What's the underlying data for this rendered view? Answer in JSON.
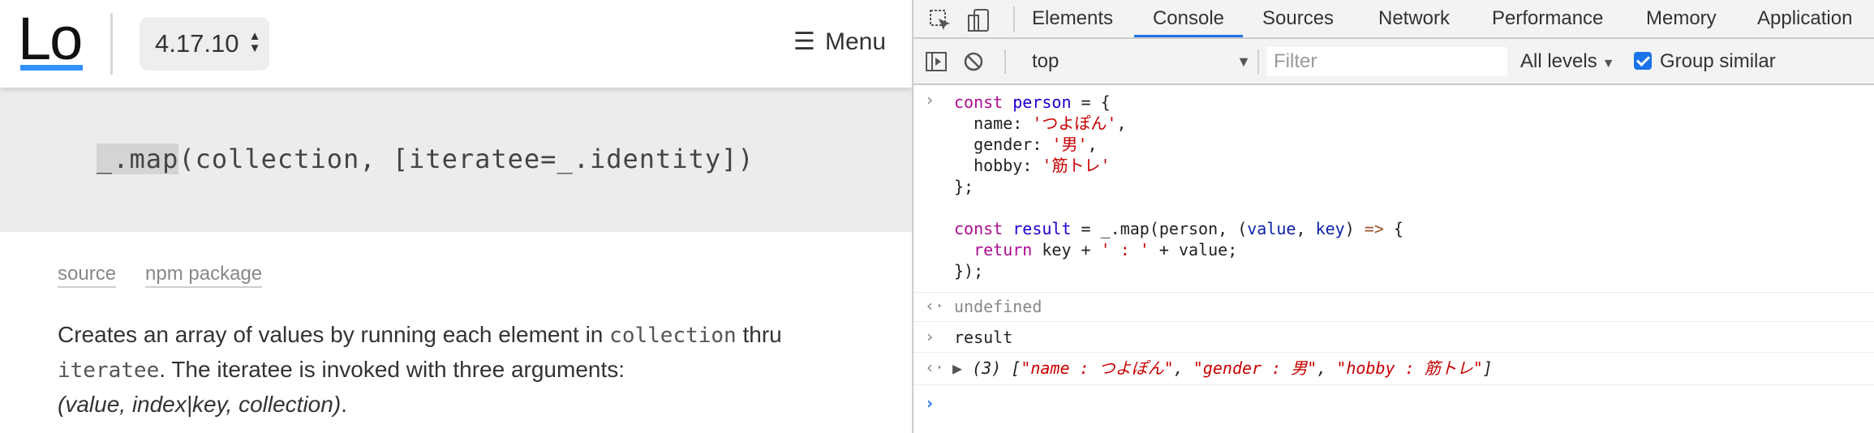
{
  "docs": {
    "logo_text": "Lo",
    "version": "4.17.10",
    "menu_label": "Menu",
    "signature": {
      "highlight": "_.map",
      "rest": "(collection, [iteratee=_.identity])"
    },
    "links": {
      "source": "source",
      "npm": "npm package"
    },
    "description": {
      "p1": "Creates an array of values by running each element in ",
      "code1": "collection",
      "p2": " thru",
      "code2": "iteratee",
      "p3": ". The iteratee is invoked with three arguments:",
      "args": "(value, index|key, collection)",
      "p4": "."
    }
  },
  "devtools": {
    "tabs": [
      "Elements",
      "Console",
      "Sources",
      "Network",
      "Performance",
      "Memory",
      "Application"
    ],
    "active_tab": "Console",
    "toolbar": {
      "context": "top",
      "filter_placeholder": "Filter",
      "levels": "All levels",
      "group_similar": "Group similar"
    },
    "console": {
      "undefined_text": "undefined",
      "result_cmd": "result",
      "output_count": "(3)",
      "output_items": [
        "\"name : つよぽん\"",
        "\"gender : 男\"",
        "\"hobby : 筋トレ\""
      ]
    }
  },
  "colors": {
    "accent": "#1a73e8",
    "logo_underline": "#3492ff",
    "string": "#c80000",
    "keyword": "#aa0d91"
  }
}
